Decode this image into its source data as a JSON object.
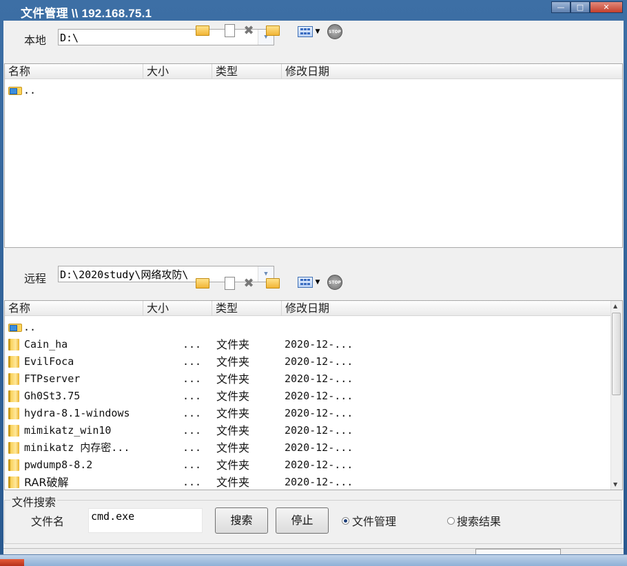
{
  "window": {
    "title": "文件管理 \\\\ 192.168.75.1"
  },
  "local": {
    "label": "本地",
    "path": "D:\\",
    "columns": [
      "名称",
      "大小",
      "类型",
      "修改日期"
    ],
    "rows": [
      {
        "name": "..",
        "size": "",
        "type": "",
        "date": "",
        "icon": "up-folder-icon"
      }
    ]
  },
  "remote": {
    "label": "远程",
    "path": "D:\\2020study\\网络攻防\\",
    "columns": [
      "名称",
      "大小",
      "类型",
      "修改日期"
    ],
    "rows": [
      {
        "name": "..",
        "size": "",
        "type": "",
        "date": "",
        "icon": "up-folder-icon"
      },
      {
        "name": "Cain_ha",
        "size": "...",
        "type": "文件夹",
        "date": "2020-12-...",
        "icon": "folder-icon"
      },
      {
        "name": "EvilFoca",
        "size": "...",
        "type": "文件夹",
        "date": "2020-12-...",
        "icon": "folder-icon"
      },
      {
        "name": "FTPserver",
        "size": "...",
        "type": "文件夹",
        "date": "2020-12-...",
        "icon": "folder-icon"
      },
      {
        "name": "Gh0St3.75",
        "size": "...",
        "type": "文件夹",
        "date": "2020-12-...",
        "icon": "folder-icon"
      },
      {
        "name": "hydra-8.1-windows",
        "size": "...",
        "type": "文件夹",
        "date": "2020-12-...",
        "icon": "folder-icon"
      },
      {
        "name": "mimikatz_win10",
        "size": "...",
        "type": "文件夹",
        "date": "2020-12-...",
        "icon": "folder-icon"
      },
      {
        "name": "minikatz 内存密...",
        "size": "...",
        "type": "文件夹",
        "date": "2020-12-...",
        "icon": "folder-icon"
      },
      {
        "name": "pwdump8-8.2",
        "size": "...",
        "type": "文件夹",
        "date": "2020-12-...",
        "icon": "folder-icon"
      },
      {
        "name": "RAR破解",
        "size": "...",
        "type": "文件夹",
        "date": "2020-12-...",
        "icon": "folder-icon"
      }
    ]
  },
  "search": {
    "group_title": "文件搜索",
    "filename_label": "文件名",
    "filename_value": "cmd.exe",
    "search_button": "搜索",
    "stop_button": "停止",
    "radio_filemanager": "文件管理",
    "radio_results": "搜索结果",
    "selected": "文件管理"
  }
}
